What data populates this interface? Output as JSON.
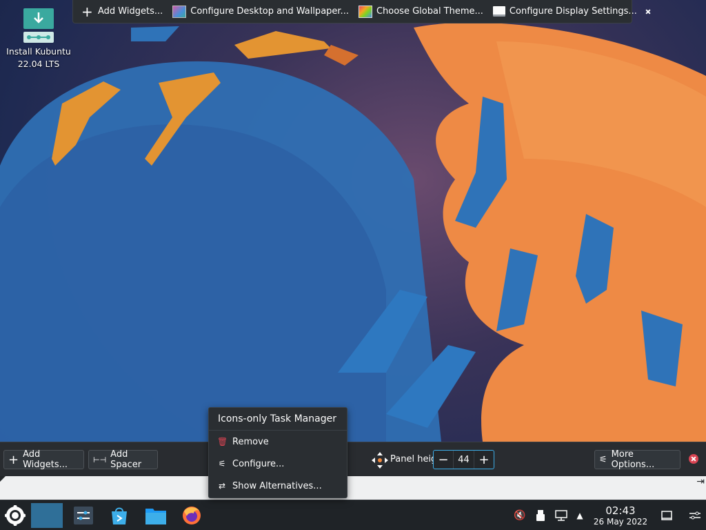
{
  "desktop": {
    "icon_label_line1": "Install Kubuntu",
    "icon_label_line2": "22.04 LTS",
    "icon_name": "kubuntu-installer-icon"
  },
  "edit_toolbar": {
    "add_widgets": "Add Widgets...",
    "configure_desktop": "Configure Desktop and Wallpaper...",
    "global_theme": "Choose Global Theme...",
    "display_settings": "Configure Display Settings..."
  },
  "panel_config": {
    "add_widgets": "Add Widgets...",
    "add_spacer": "Add Spacer",
    "panel_height_label": "Panel height:",
    "panel_height_value": "44",
    "more_options": "More Options..."
  },
  "context_menu": {
    "title": "Icons-only Task Manager",
    "items": [
      {
        "label": "Remove",
        "icon": "trash-icon"
      },
      {
        "label": "Configure...",
        "icon": "configure-icon"
      },
      {
        "label": "Show Alternatives...",
        "icon": "alternatives-icon"
      }
    ]
  },
  "taskbar": {
    "time": "02:43",
    "date": "26 May 2022"
  },
  "colors": {
    "accent": "#3daee9",
    "close_red": "#da4453",
    "panel_bg": "#292c30",
    "wallpaper_orange": "#f0883e",
    "wallpaper_blue": "#2f73b8"
  }
}
